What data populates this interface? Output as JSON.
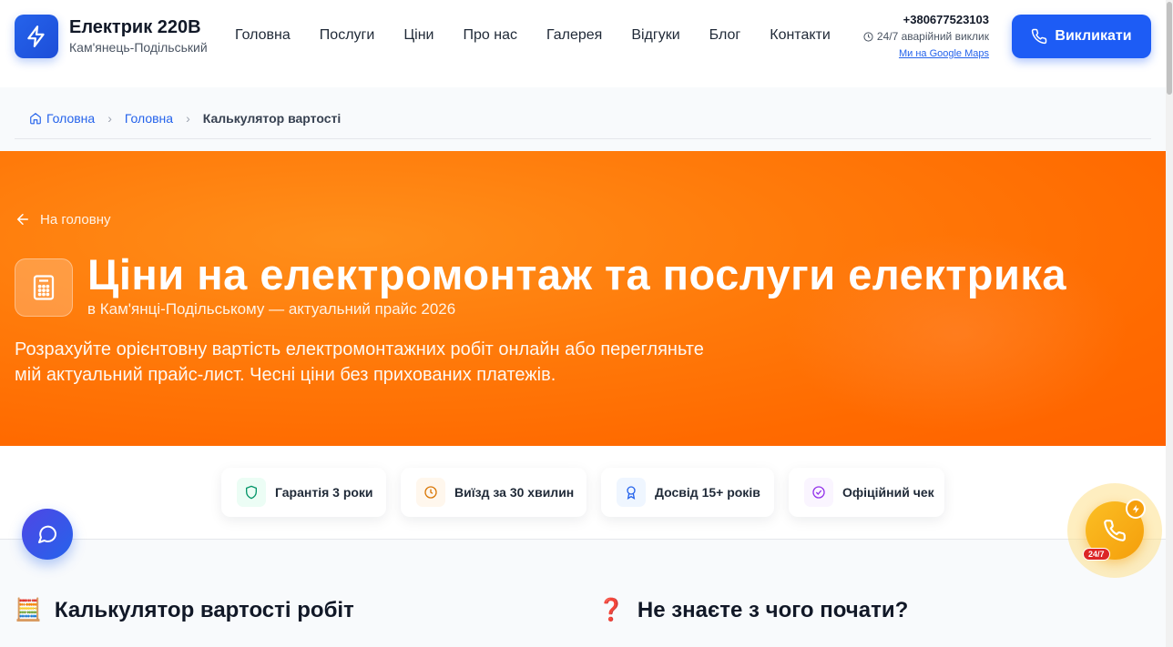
{
  "header": {
    "brand_title": "Електрик 220В",
    "brand_sub": "Кам'янець-Подільський",
    "nav": [
      "Головна",
      "Послуги",
      "Ціни",
      "Про нас",
      "Галерея",
      "Відгуки",
      "Блог",
      "Контакти"
    ],
    "phone": "+380677523103",
    "emergency": "24/7 аварійний виклик",
    "maps_link": "Ми на Google Maps",
    "call_button": "Викликати"
  },
  "breadcrumb": {
    "items": [
      "Головна",
      "Головна"
    ],
    "current": "Калькулятор вартості"
  },
  "hero": {
    "back_link": "На головну",
    "title": "Ціни на електромонтаж та послуги електрика",
    "subtitle": "в Кам'янці-Подільському — актуальний прайс 2026",
    "description": "Розрахуйте орієнтовну вартість електромонтажних робіт онлайн або перегляньте мій актуальний прайс-лист. Чесні ціни без прихованих платежів."
  },
  "features": [
    {
      "label": "Гарантія 3 роки",
      "icon": "shield-icon",
      "color": "#059669",
      "bg": "#ecfdf5"
    },
    {
      "label": "Виїзд за 30 хвилин",
      "icon": "clock-icon",
      "color": "#d97706",
      "bg": "#fff7ed"
    },
    {
      "label": "Досвід 15+ років",
      "icon": "award-icon",
      "color": "#2563eb",
      "bg": "#eff6ff"
    },
    {
      "label": "Офіційний чек",
      "icon": "check-circle-icon",
      "color": "#9333ea",
      "bg": "#faf5ff"
    }
  ],
  "floating": {
    "badge": "24/7"
  },
  "sections": {
    "calculator_emoji": "🧮",
    "calculator_title": "Калькулятор вартості робіт",
    "help_emoji": "❓",
    "help_title": "Не знаєте з чого почати?"
  },
  "colors": {
    "primary": "#1d5cf5",
    "hero_orange": "#ff6a00",
    "accent_yellow": "#f59e0b"
  }
}
